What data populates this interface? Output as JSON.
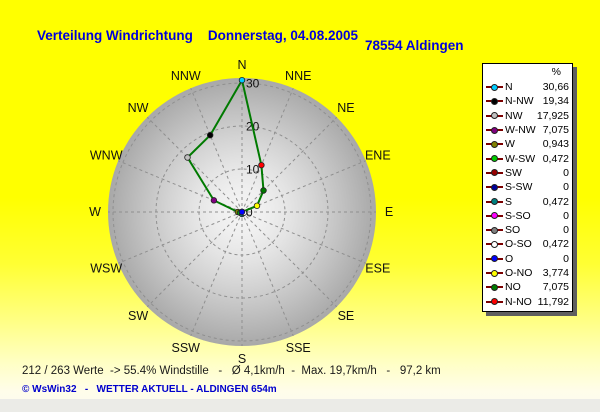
{
  "header": {
    "title": "Verteilung Windrichtung",
    "date": "Donnerstag, 04.08.2005",
    "station": "78554 Aldingen"
  },
  "status_line": "212 / 263 Werte  -> 55.4% Windstille   -   Ø 4,1km/h  -  Max. 19,7km/h   -   97,2 km",
  "footer": "© WsWin32   -   WETTER AKTUELL - ALDINGEN 654m",
  "colors": {
    "background_top": "#ffff00",
    "background_bottom": "#fcfbf0",
    "title_text": "#0000dc",
    "footer_text": "#0000cc",
    "grid": "#8f8f8f",
    "disk_center": "#f4f4f4",
    "disk_edge": "#a8a8a8"
  },
  "chart_data": {
    "type": "radar",
    "title": "Verteilung Windrichtung",
    "units": "%",
    "axis_max": 30,
    "axis_ticks": [
      0,
      10,
      20,
      30
    ],
    "grid": "dashed, 16 spokes every 22.5 degrees, rings at 10/20/30",
    "legend_position": "right",
    "legend_header": "%",
    "line_color": "#007a00",
    "legend_line_color": "#7b0000",
    "compass_labels_clockwise": [
      "N",
      "NNE",
      "NE",
      "ENE",
      "E",
      "ESE",
      "SE",
      "SSE",
      "S",
      "SSW",
      "SW",
      "WSW",
      "W",
      "WNW",
      "NW",
      "NNW"
    ],
    "series": [
      {
        "name": "N",
        "angle_deg": 0,
        "value": 30.66,
        "display": "30,66",
        "marker_color": "#00ccff"
      },
      {
        "name": "N-NW",
        "angle_deg": 337.5,
        "value": 19.34,
        "display": "19,34",
        "marker_color": "#000000"
      },
      {
        "name": "NW",
        "angle_deg": 315,
        "value": 17.925,
        "display": "17,925",
        "marker_color": "#c0c0c0"
      },
      {
        "name": "W-NW",
        "angle_deg": 292.5,
        "value": 7.075,
        "display": "7,075",
        "marker_color": "#800080"
      },
      {
        "name": "W",
        "angle_deg": 270,
        "value": 0.943,
        "display": "0,943",
        "marker_color": "#808000"
      },
      {
        "name": "W-SW",
        "angle_deg": 247.5,
        "value": 0.472,
        "display": "0,472",
        "marker_color": "#00cc00"
      },
      {
        "name": "SW",
        "angle_deg": 225,
        "value": 0,
        "display": "0",
        "marker_color": "#990000"
      },
      {
        "name": "S-SW",
        "angle_deg": 202.5,
        "value": 0,
        "display": "0",
        "marker_color": "#000099"
      },
      {
        "name": "S",
        "angle_deg": 180,
        "value": 0.472,
        "display": "0,472",
        "marker_color": "#008080"
      },
      {
        "name": "S-SO",
        "angle_deg": 157.5,
        "value": 0,
        "display": "0",
        "marker_color": "#ff00ff"
      },
      {
        "name": "SO",
        "angle_deg": 135,
        "value": 0,
        "display": "0",
        "marker_color": "#808080"
      },
      {
        "name": "O-SO",
        "angle_deg": 112.5,
        "value": 0.472,
        "display": "0,472",
        "marker_color": "#ffffff"
      },
      {
        "name": "O",
        "angle_deg": 90,
        "value": 0,
        "display": "0",
        "marker_color": "#0000ff"
      },
      {
        "name": "O-NO",
        "angle_deg": 67.5,
        "value": 3.774,
        "display": "3,774",
        "marker_color": "#ffff00"
      },
      {
        "name": "NO",
        "angle_deg": 45,
        "value": 7.075,
        "display": "7,075",
        "marker_color": "#007a00"
      },
      {
        "name": "N-NO",
        "angle_deg": 22.5,
        "value": 11.792,
        "display": "11,792",
        "marker_color": "#ff0000"
      }
    ]
  }
}
